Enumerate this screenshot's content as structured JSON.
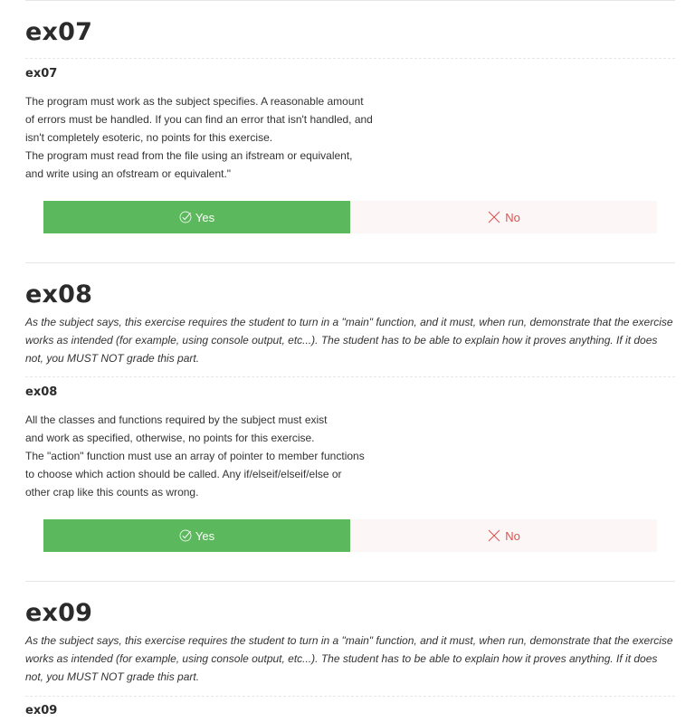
{
  "sections": [
    {
      "title": "ex07",
      "subtitle": "ex07",
      "description": [
        "The program must work as the subject specifies. A reasonable amount",
        "of errors must be handled. If you can find an error that isn't handled, and",
        "isn't completely esoteric, no points for this exercise.",
        "The program must read from the file using an ifstream or equivalent,",
        "and write using an ofstream or equivalent.\""
      ],
      "yes_label": "Yes",
      "no_label": "No"
    },
    {
      "title": "ex08",
      "intro": "As the subject says, this exercise requires the student to turn in a \"main\" function, and it must, when run, demonstrate that the exercise works as intended (for example, using console output, etc...). The student has to be able to explain how it proves anything. If it does not, you MUST NOT grade this part.",
      "subtitle": "ex08",
      "description": [
        "All the classes and functions required by the subject must exist",
        "and work as specified, otherwise, no points for this exercise.",
        "The \"action\" function must use an array of pointer to member functions",
        "to choose which action should be called. Any if/elseif/elseif/else or",
        "other crap like this counts as wrong."
      ],
      "yes_label": "Yes",
      "no_label": "No"
    },
    {
      "title": "ex09",
      "intro": "As the subject says, this exercise requires the student to turn in a \"main\" function, and it must, when run, demonstrate that the exercise works as intended (for example, using console output, etc...). The student has to be able to explain how it proves anything. If it does not, you MUST NOT grade this part.",
      "subtitle": "ex09"
    }
  ],
  "icons": {
    "yes": "check-circle-icon",
    "no": "cross-icon"
  },
  "colors": {
    "yes_bg": "#5cb85c",
    "no_bg": "#fdf6f6",
    "no_text": "#d9534f"
  }
}
